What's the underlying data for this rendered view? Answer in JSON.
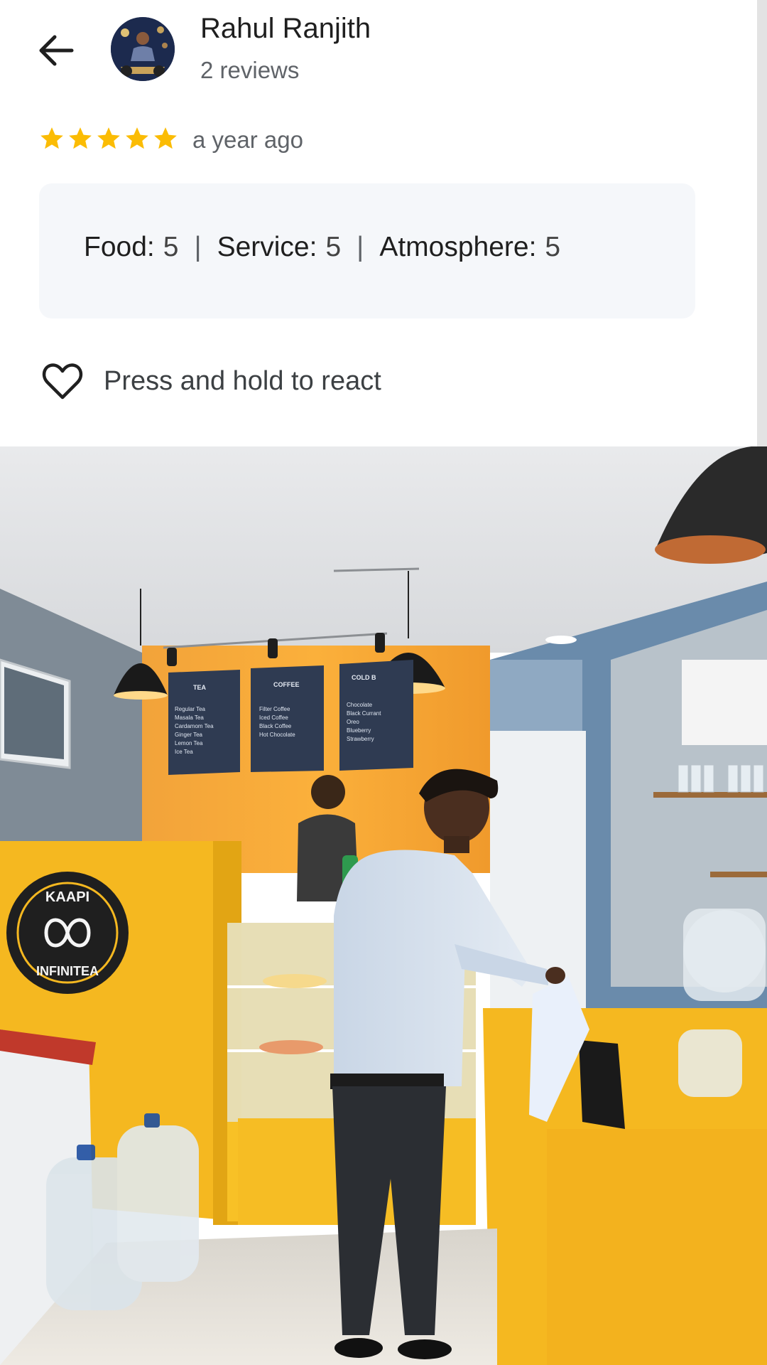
{
  "reviewer": {
    "name": "Rahul Ranjith",
    "reviews_count": "2 reviews"
  },
  "review": {
    "stars": 5,
    "star_color": "#fbbc04",
    "time": "a year ago",
    "ratings": [
      {
        "label": "Food:",
        "value": "5"
      },
      {
        "label": "Service:",
        "value": "5"
      },
      {
        "label": "Atmosphere:",
        "value": "5"
      }
    ]
  },
  "reaction": {
    "label": "Press and hold to react"
  },
  "photo": {
    "logo_line1": "KAAPI",
    "logo_line2": "INFINITEA",
    "menu_boards": [
      {
        "title": "TEA",
        "items": [
          "Regular Tea",
          "Masala Tea",
          "Cardamom Tea",
          "Ginger Tea",
          "Lemon Tea",
          "Ice Tea"
        ]
      },
      {
        "title": "COFFEE",
        "items": [
          "Filter Coffee",
          "Iced Coffee",
          "Black Coffee",
          "Hot Chocolate"
        ]
      },
      {
        "title": "COLD B",
        "items": [
          "Chocolate",
          "Black Currant",
          "Oreo",
          "Blueberry",
          "Strawberry"
        ]
      }
    ]
  },
  "icons": {
    "back": "arrow-left-icon",
    "star": "star-icon",
    "heart": "heart-outline-icon"
  }
}
